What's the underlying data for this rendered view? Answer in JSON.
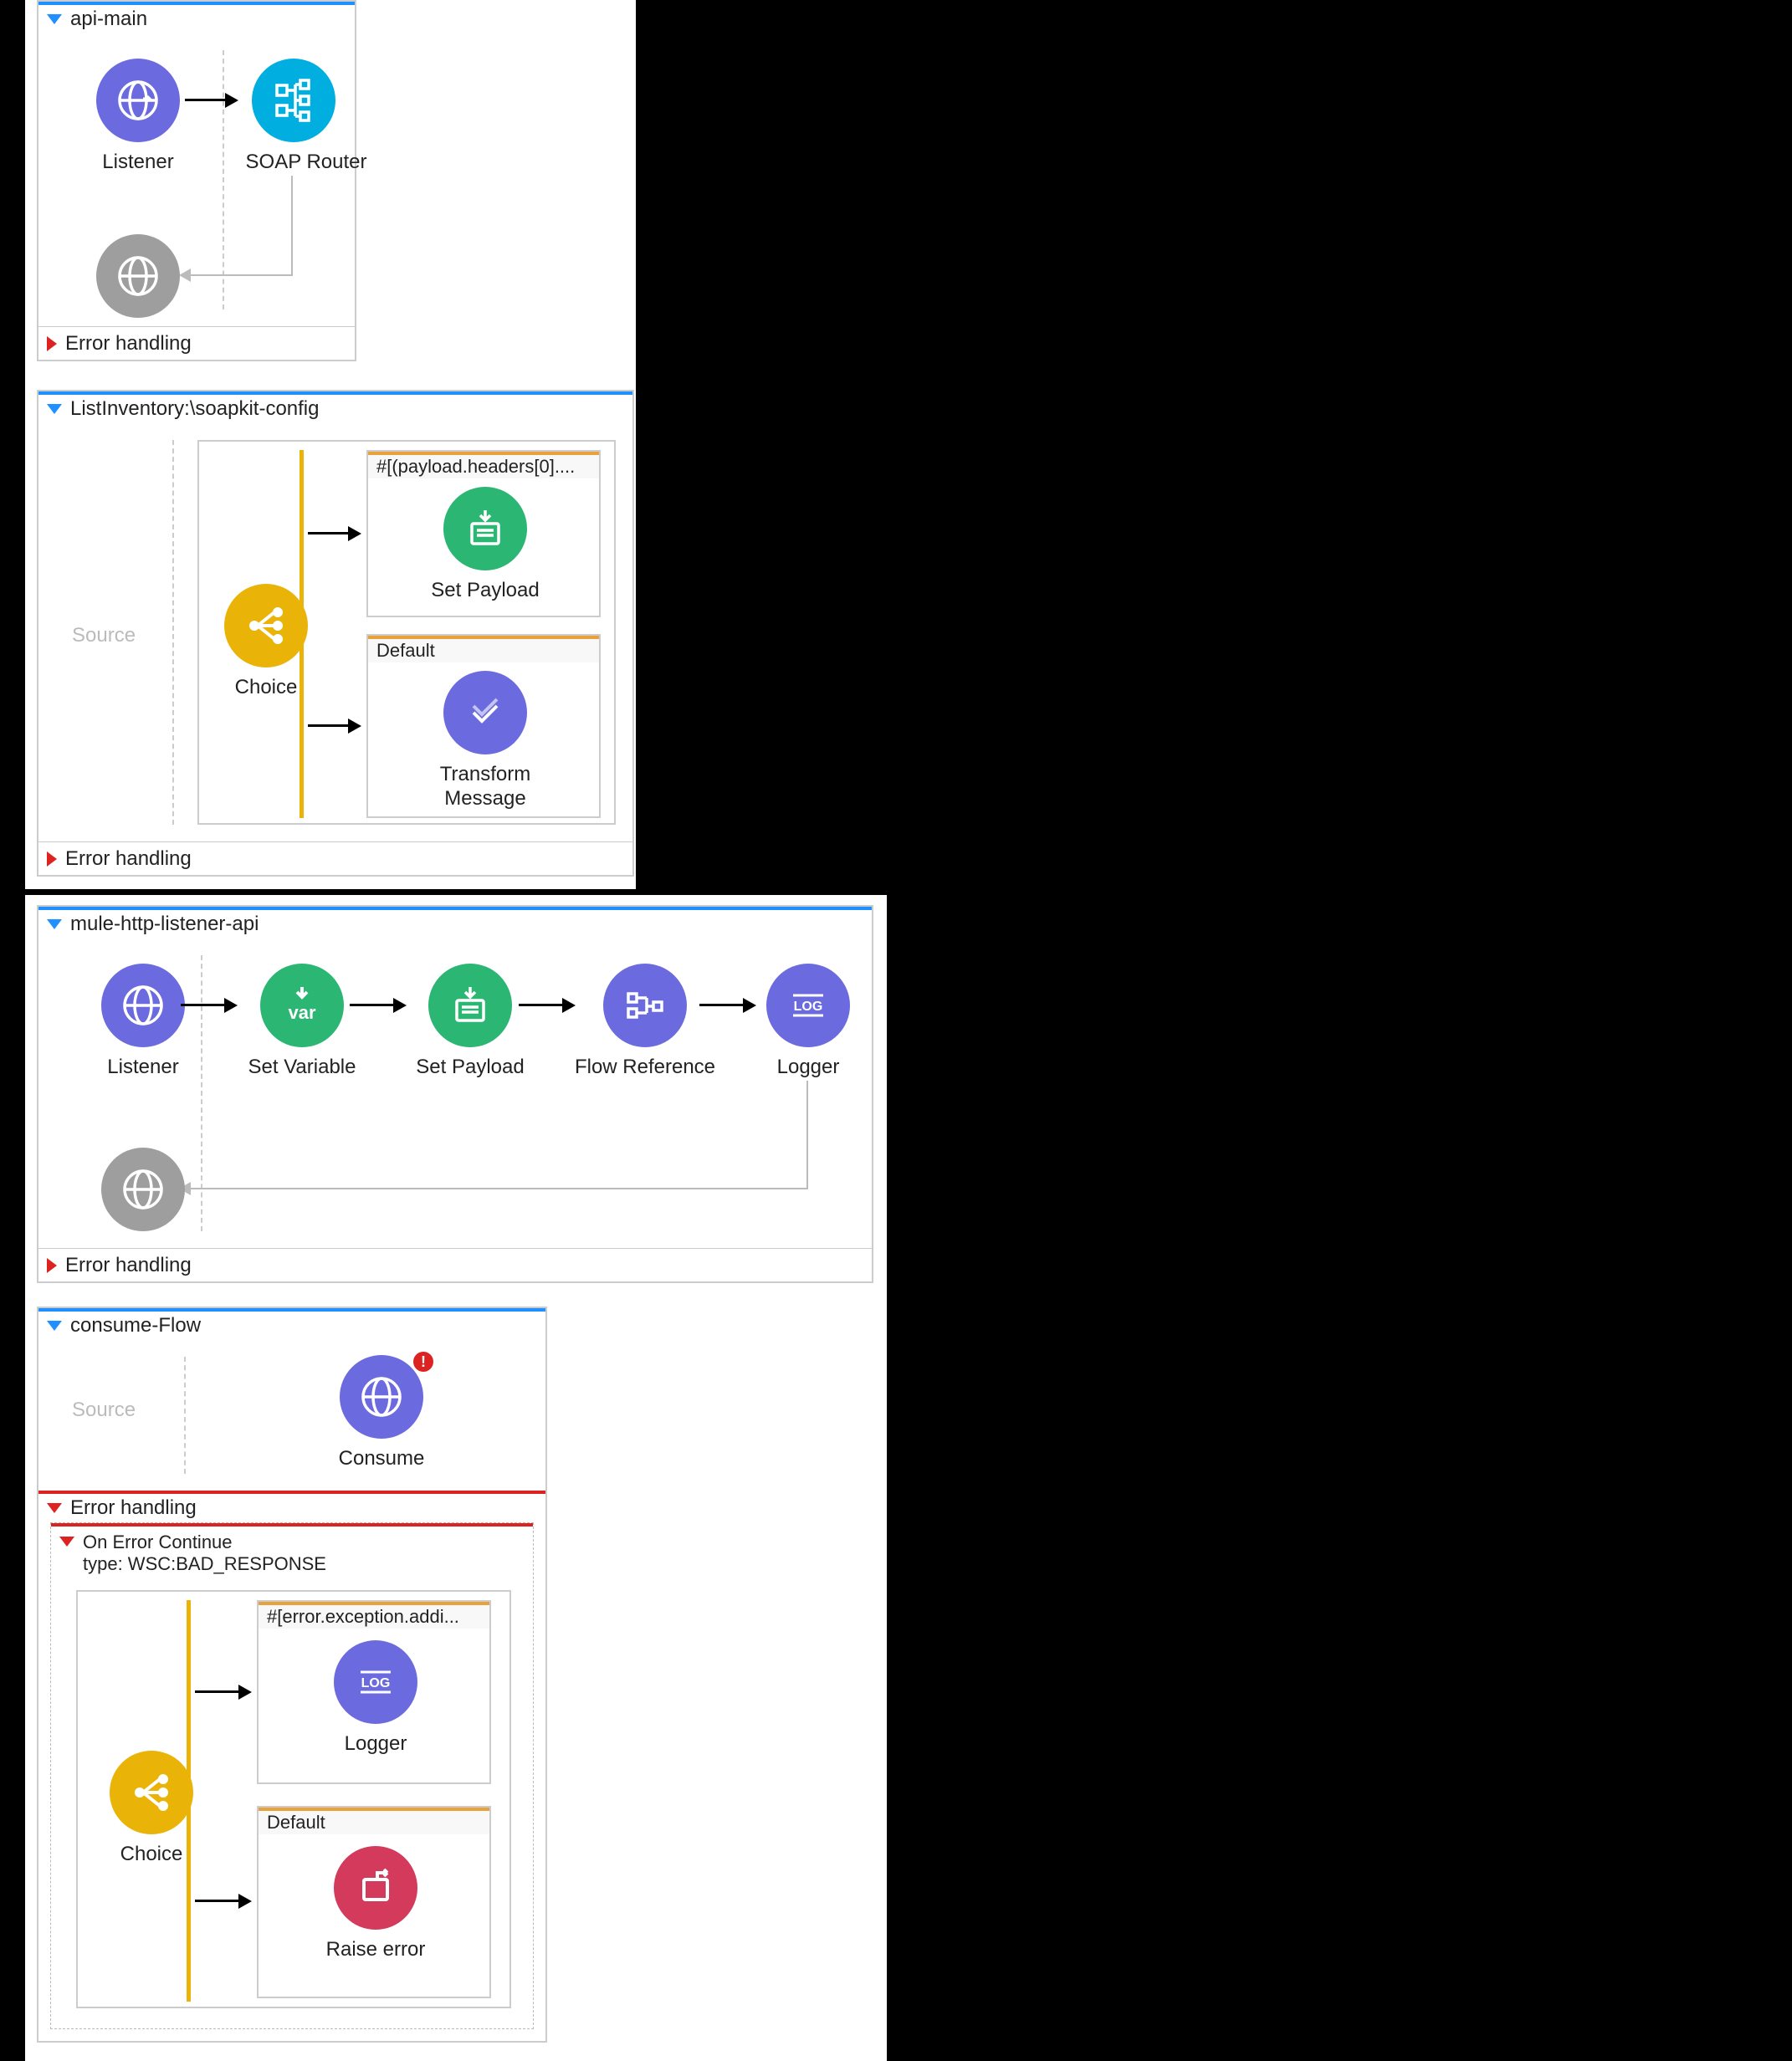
{
  "flows": {
    "apiMain": {
      "title": "api-main",
      "errorFooter": "Error handling",
      "nodes": {
        "listener": "Listener",
        "soapRouter": "SOAP Router"
      }
    },
    "listInventory": {
      "title": "ListInventory:\\soapkit-config",
      "errorFooter": "Error handling",
      "sourceLabel": "Source",
      "choice": {
        "label": "Choice",
        "route1Header": "#[(payload.headers[0]....",
        "route1Node": "Set Payload",
        "defaultHeader": "Default",
        "defaultNode": "Transform Message"
      }
    },
    "httpListener": {
      "title": "mule-http-listener-api",
      "errorFooter": "Error handling",
      "nodes": {
        "listener": "Listener",
        "setVariable": "Set Variable",
        "setPayload": "Set Payload",
        "flowRef": "Flow Reference",
        "logger": "Logger"
      }
    },
    "consumeFlow": {
      "title": "consume-Flow",
      "sourceLabel": "Source",
      "consumeLabel": "Consume",
      "errorSection": {
        "title": "Error handling",
        "scopeTitle": "On Error Continue",
        "scopeType": "type: WSC:BAD_RESPONSE",
        "choice": {
          "label": "Choice",
          "route1Header": "#[error.exception.addi...",
          "route1Node": "Logger",
          "defaultHeader": "Default",
          "defaultNode": "Raise error"
        }
      }
    }
  }
}
